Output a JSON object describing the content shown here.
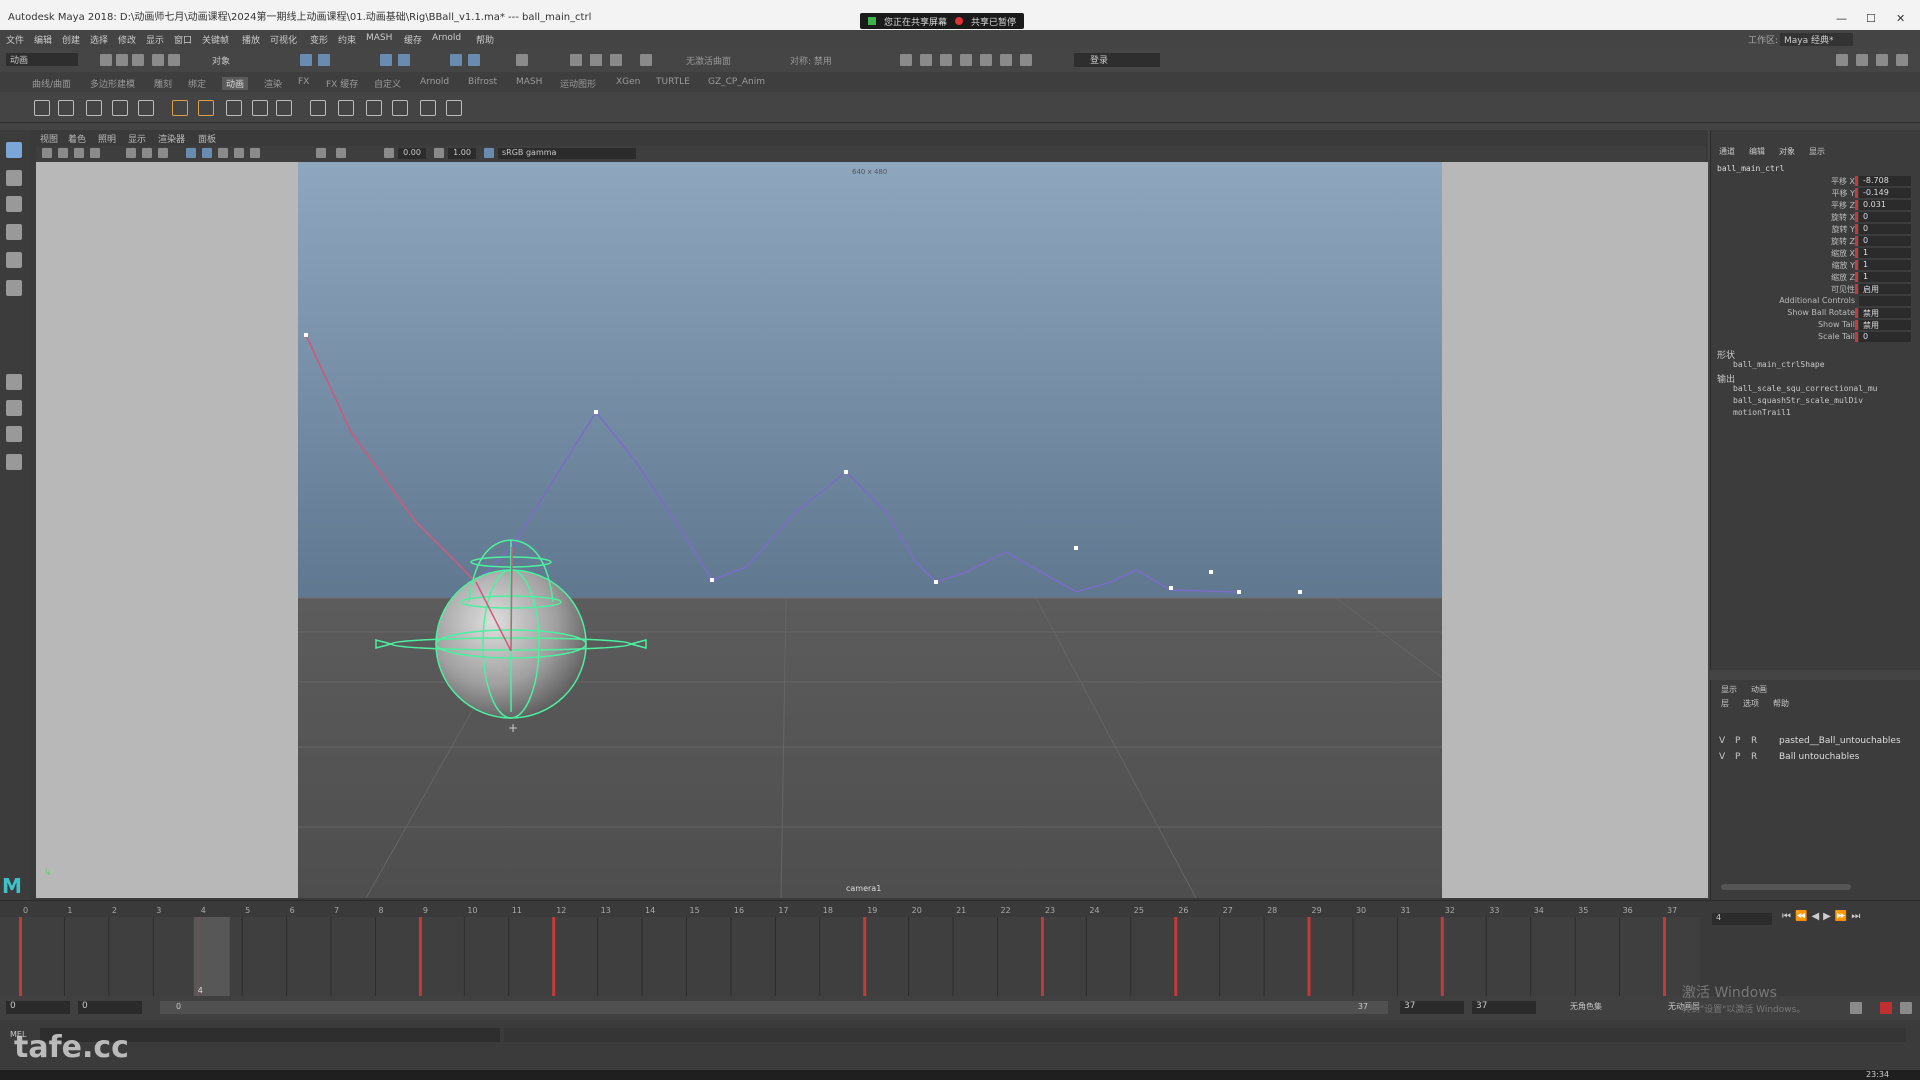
{
  "app": {
    "title": "Autodesk Maya 2018: D:\\动画师七月\\动画课程\\2024第一期线上动画课程\\01.动画基础\\Rig\\BBall_v1.1.ma*  ---  ball_main_ctrl",
    "share_label": "您正在共享屏幕",
    "share_stop": "共享已暂停",
    "workspace_label": "工作区:",
    "workspace_value": "Maya 经典*"
  },
  "menus": [
    "文件",
    "编辑",
    "创建",
    "选择",
    "修改",
    "显示",
    "窗口",
    "关键帧",
    "播放",
    "可视化",
    "变形",
    "约束",
    "MASH",
    "缓存",
    "Arnold",
    "帮助"
  ],
  "statusline": {
    "mode": "动画",
    "object_label": "对象",
    "surface": "无激活曲面",
    "symmetry": "对称: 禁用",
    "login": "登录"
  },
  "shelf_tabs": [
    "曲线/曲面",
    "多边形建模",
    "雕刻",
    "绑定",
    "动画",
    "渲染",
    "FX",
    "FX 缓存",
    "自定义",
    "Arnold",
    "Bifrost",
    "MASH",
    "运动图形",
    "XGen",
    "TURTLE",
    "GZ_CP_Anim"
  ],
  "shelf_active": "动画",
  "viewport": {
    "menus": [
      "视图",
      "着色",
      "照明",
      "显示",
      "渲染器",
      "面板"
    ],
    "exposure": "0.00",
    "gamma": "1.00",
    "colorspace": "sRGB gamma",
    "resolution": "640 x 480",
    "camera": "camera1"
  },
  "channel_box": {
    "tabs": [
      "通道",
      "编辑",
      "对象",
      "显示"
    ],
    "object": "ball_main_ctrl",
    "channels": [
      {
        "label": "平移 X",
        "value": "-8.708",
        "keyed": true
      },
      {
        "label": "平移 Y",
        "value": "-0.149",
        "keyed": true
      },
      {
        "label": "平移 Z",
        "value": "0.031",
        "keyed": true
      },
      {
        "label": "旋转 X",
        "value": "0",
        "keyed": true
      },
      {
        "label": "旋转 Y",
        "value": "0",
        "keyed": true
      },
      {
        "label": "旋转 Z",
        "value": "0",
        "keyed": true
      },
      {
        "label": "缩放 X",
        "value": "1",
        "keyed": true
      },
      {
        "label": "缩放 Y",
        "value": "1",
        "keyed": true
      },
      {
        "label": "缩放 Z",
        "value": "1",
        "keyed": true
      },
      {
        "label": "可见性",
        "value": "启用",
        "keyed": true
      },
      {
        "label": "Additional Controls",
        "value": "",
        "keyed": false
      },
      {
        "label": "Show Ball Rotate",
        "value": "禁用",
        "keyed": true
      },
      {
        "label": "Show Tail",
        "value": "禁用",
        "keyed": true
      },
      {
        "label": "Scale Tail",
        "value": "0",
        "keyed": true
      }
    ],
    "shapes_header": "形状",
    "shape": "ball_main_ctrlShape",
    "outputs_header": "输出",
    "outputs": [
      "ball_scale_squ_correctional_mu",
      "ball_squashStr_scale_mulDiv",
      "motionTrail1"
    ]
  },
  "layers": {
    "tabs": [
      "显示",
      "动画"
    ],
    "menus": [
      "层",
      "选项",
      "帮助"
    ],
    "rows": [
      {
        "v": "V",
        "p": "P",
        "r": "R",
        "name": "pasted__Ball_untouchables"
      },
      {
        "v": "V",
        "p": "P",
        "r": "R",
        "name": "Ball untouchables"
      }
    ]
  },
  "timeline": {
    "ticks": [
      "0",
      "1",
      "2",
      "3",
      "4",
      "5",
      "6",
      "7",
      "8",
      "9",
      "10",
      "11",
      "12",
      "13",
      "14",
      "15",
      "16",
      "17",
      "18",
      "19",
      "20",
      "21",
      "22",
      "23",
      "24",
      "25",
      "26",
      "27",
      "28",
      "29",
      "30",
      "31",
      "32",
      "33",
      "34",
      "35",
      "36",
      "37"
    ],
    "current_frame": "4",
    "current_frame_field": "4",
    "keys": [
      0,
      4,
      9,
      12,
      19,
      23,
      26,
      29,
      32,
      37
    ]
  },
  "range": {
    "start": "0",
    "anim_start": "0",
    "range_start": "0",
    "range_end": "37",
    "anim_end": "37",
    "end": "37",
    "char_set": "无角色集",
    "anim_layer": "无动画层"
  },
  "cmd": {
    "lang": "MEL",
    "watermark": "tafe.cc",
    "activate_windows": "激活 Windows",
    "activate_hint": "转到\"设置\"以激活 Windows。",
    "clock": "23:34"
  },
  "colors": {
    "accent_green": "#4cf0a0",
    "key_red": "#c23b3b",
    "trail": "#7a6cc8",
    "trail_red": "#d05a7a"
  }
}
